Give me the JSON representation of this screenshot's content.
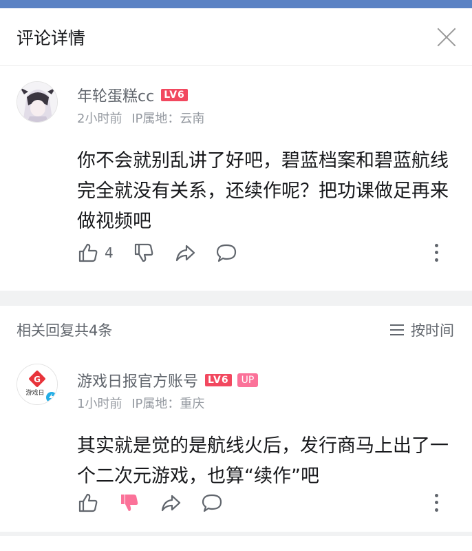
{
  "header": {
    "title": "评论详情"
  },
  "main_comment": {
    "username": "年轮蛋糕cc",
    "level": "LV6",
    "time": "2小时前",
    "ip": "IP属地：云南",
    "content": "你不会就别乱讲了好吧，碧蓝档案和碧蓝航线完全就没有关系，还续作呢？把功课做足再来做视频吧",
    "like_count": "4"
  },
  "replies_header": {
    "title": "相关回复共4条",
    "sort_label": "按时间"
  },
  "reply": {
    "username": "游戏日报官方账号",
    "level": "LV6",
    "up_badge": "UP",
    "time": "1小时前",
    "ip": "IP属地：重庆",
    "content": "其实就是觉的是航线火后，发行商马上出了一个二次元游戏，也算“续作”吧",
    "avatar_logo_letter": "G",
    "avatar_logo_text": "游戏日"
  },
  "colors": {
    "accent": "#fb7299",
    "level_badge": "#f2485f",
    "top_bar": "#5b82c4"
  },
  "icons": [
    "close-icon",
    "thumbs-up-icon",
    "thumbs-down-icon",
    "share-icon",
    "comment-icon",
    "more-icon",
    "sort-icon"
  ]
}
